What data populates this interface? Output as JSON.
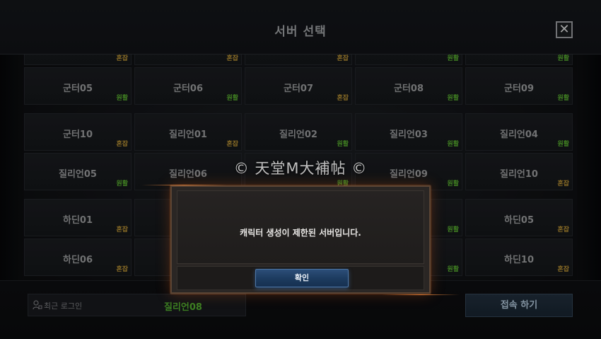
{
  "header": {
    "title": "서버 선택",
    "close_glyph": "✕"
  },
  "status_labels": {
    "busy": "혼잡",
    "smooth": "원활"
  },
  "colors": {
    "busy": "#a9852f",
    "smooth": "#4f9d2a",
    "dialog_glow": "#c85a1e",
    "confirm_button": "#1c3a5e"
  },
  "server_rows": [
    {
      "row": "top-partial",
      "cells": [
        {
          "name": "",
          "status": "busy"
        },
        {
          "name": "",
          "status": "busy"
        },
        {
          "name": "",
          "status": "busy"
        },
        {
          "name": "",
          "status": "smooth"
        },
        {
          "name": "",
          "status": "smooth"
        }
      ]
    },
    {
      "row": "gunter-1",
      "cells": [
        {
          "name": "군터05",
          "status": "smooth"
        },
        {
          "name": "군터06",
          "status": "smooth"
        },
        {
          "name": "군터07",
          "status": "busy"
        },
        {
          "name": "군터08",
          "status": "smooth"
        },
        {
          "name": "군터09",
          "status": "smooth"
        }
      ]
    },
    {
      "row": "mixed-1",
      "cells": [
        {
          "name": "군터10",
          "status": "busy"
        },
        {
          "name": "질리언01",
          "status": "busy"
        },
        {
          "name": "질리언02",
          "status": "smooth"
        },
        {
          "name": "질리언03",
          "status": "smooth"
        },
        {
          "name": "질리언04",
          "status": "smooth"
        }
      ]
    },
    {
      "row": "gillian-2",
      "cells": [
        {
          "name": "질리언05",
          "status": "smooth"
        },
        {
          "name": "질리언06",
          "status": ""
        },
        {
          "name": "",
          "status": "smooth"
        },
        {
          "name": "질리언09",
          "status": "smooth"
        },
        {
          "name": "질리언10",
          "status": "busy"
        }
      ]
    },
    {
      "row": "hadin-1",
      "cells": [
        {
          "name": "하딘01",
          "status": "busy"
        },
        {
          "name": "",
          "status": ""
        },
        {
          "name": "",
          "status": ""
        },
        {
          "name": "",
          "status": "smooth"
        },
        {
          "name": "하딘05",
          "status": "busy"
        }
      ]
    },
    {
      "row": "hadin-2",
      "cells": [
        {
          "name": "하딘06",
          "status": "busy"
        },
        {
          "name": "",
          "status": ""
        },
        {
          "name": "",
          "status": ""
        },
        {
          "name": "",
          "status": "smooth"
        },
        {
          "name": "하딘10",
          "status": "busy"
        }
      ]
    }
  ],
  "watermark": "© 天堂M大補帖 ©",
  "footer": {
    "recent_login_label": "최근 로그인",
    "recent_server": "질리언08",
    "connect_button": "접속 하기"
  },
  "dialog": {
    "message": "캐릭터 생성이 제한된 서버입니다.",
    "confirm_button": "확인"
  }
}
